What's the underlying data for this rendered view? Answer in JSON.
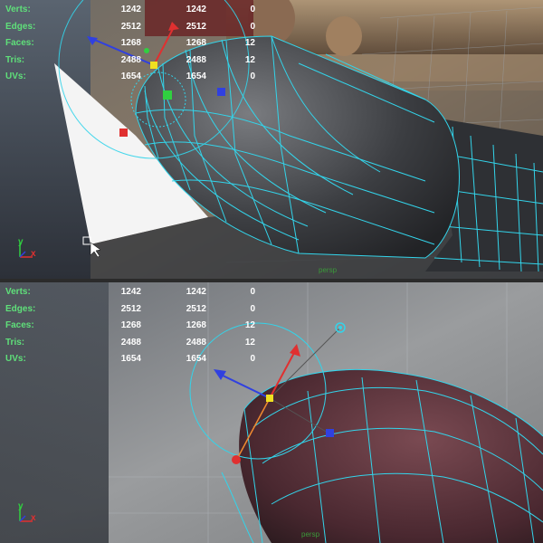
{
  "stats_headings": [
    "Verts:",
    "Edges:",
    "Faces:",
    "Tris:",
    "UVs:"
  ],
  "top_viewport": {
    "stats": [
      [
        "1242",
        "1242",
        "0"
      ],
      [
        "2512",
        "2512",
        "0"
      ],
      [
        "1268",
        "1268",
        "12"
      ],
      [
        "2488",
        "2488",
        "12"
      ],
      [
        "1654",
        "1654",
        "0"
      ]
    ],
    "camera_label": "persp"
  },
  "bottom_viewport": {
    "stats": [
      [
        "1242",
        "1242",
        "0"
      ],
      [
        "2512",
        "2512",
        "0"
      ],
      [
        "1268",
        "1268",
        "12"
      ],
      [
        "2488",
        "2488",
        "12"
      ],
      [
        "1654",
        "1654",
        "0"
      ]
    ],
    "camera_label": "persp"
  },
  "axis_labels": {
    "y": "y",
    "x": "x"
  },
  "colors": {
    "stat_label": "#5fe07a",
    "wireframe": "#33d4ea",
    "axis_x": "#e03030",
    "axis_y": "#30d040",
    "axis_z": "#3040e0",
    "pivot": "#f0e020"
  },
  "icons": [
    "mouse-cursor-icon",
    "axis-gizmo-icon",
    "rotate-manipulator-icon"
  ]
}
